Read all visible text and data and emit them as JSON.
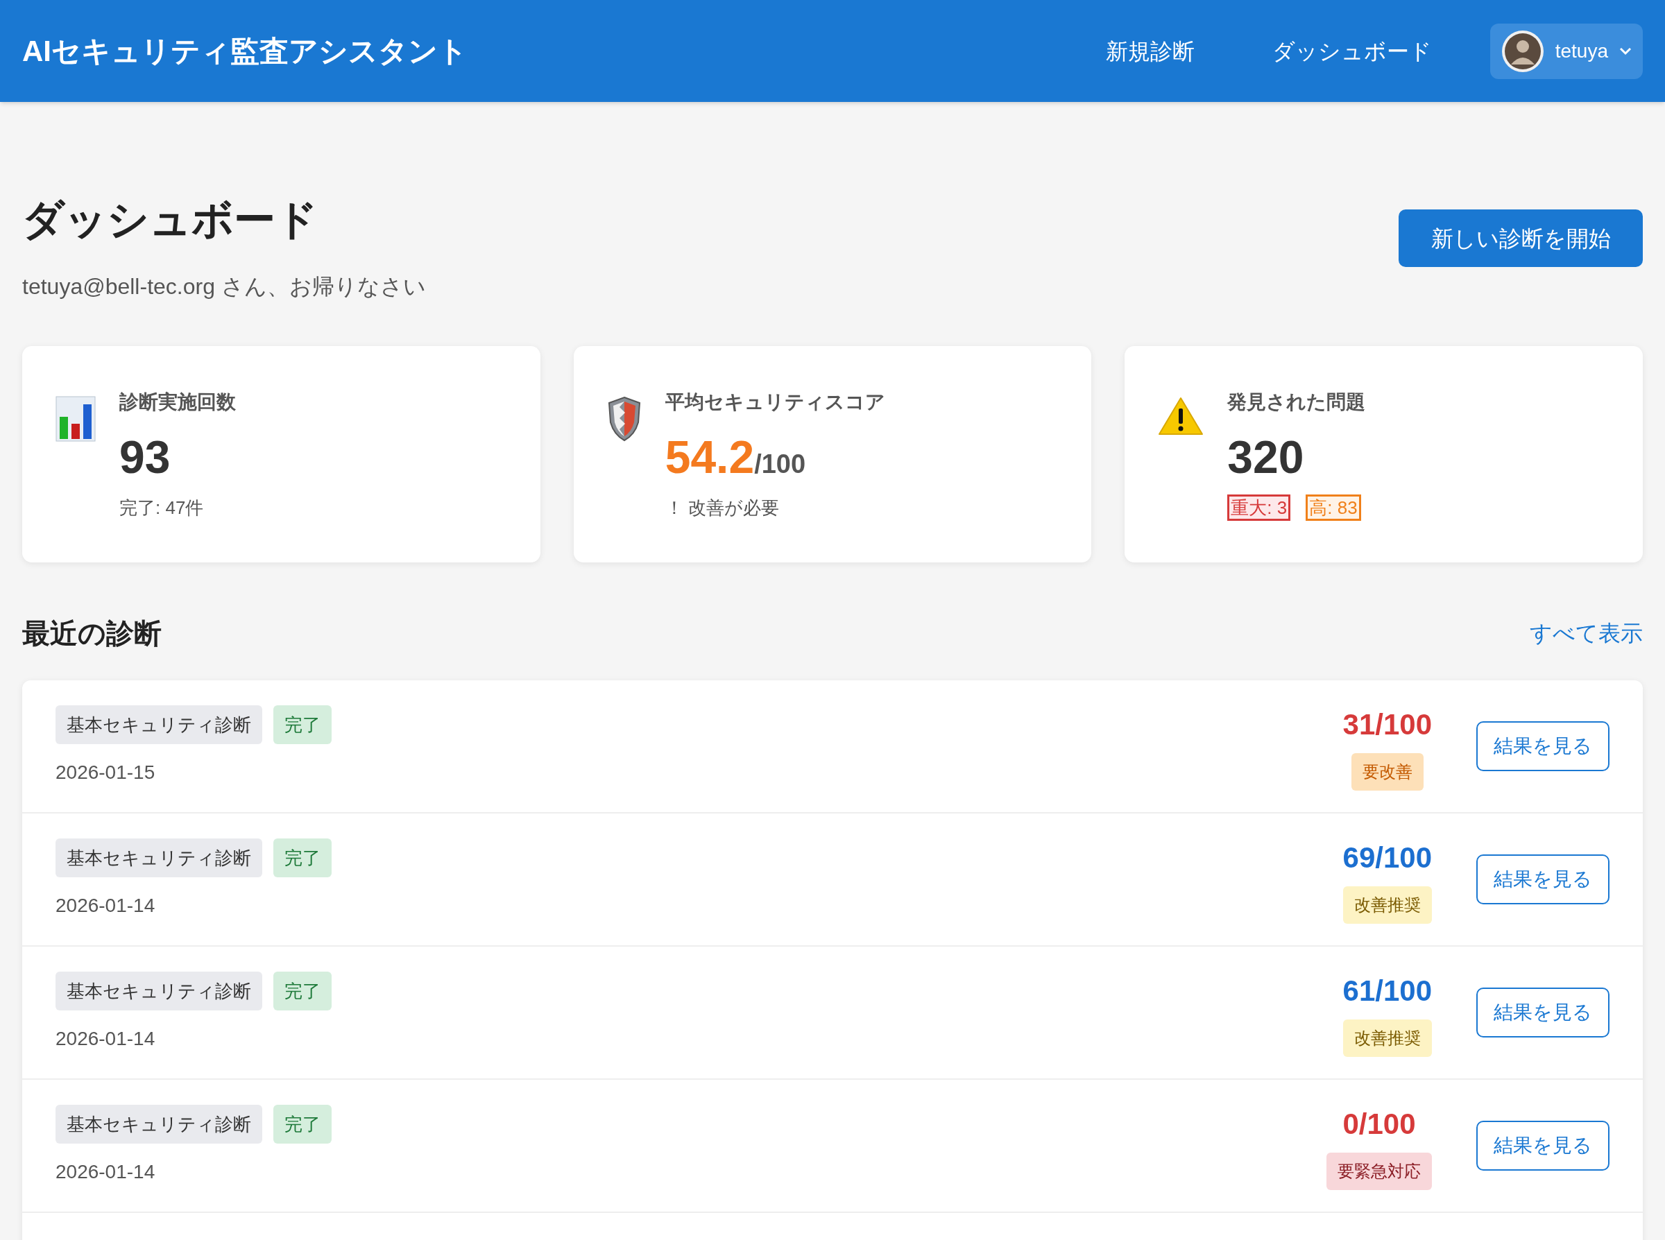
{
  "header": {
    "title": "AIセキュリティ監査アシスタント",
    "nav": [
      {
        "label": "新規診断"
      },
      {
        "label": "ダッシュボード"
      }
    ],
    "user": {
      "name": "tetuya"
    }
  },
  "page": {
    "title": "ダッシュボード",
    "greeting": "tetuya@bell-tec.org さん、お帰りなさい",
    "action": "新しい診断を開始"
  },
  "stats": [
    {
      "kind": "count",
      "label": "診断実施回数",
      "value": "93",
      "note": "完了: 47件"
    },
    {
      "kind": "score",
      "label": "平均セキュリティスコア",
      "value": "54.2",
      "suffix": "/100",
      "note": "！ 改善が必要"
    },
    {
      "kind": "issues",
      "label": "発見された問題",
      "value": "320",
      "badges": [
        {
          "kind": "critical",
          "text": "重大: 3"
        },
        {
          "kind": "high",
          "text": "高: 83"
        }
      ]
    }
  ],
  "recent": {
    "title": "最近の診断",
    "link": "すべて表示",
    "rows": [
      {
        "type": "基本セキュリティ診断",
        "status": "完了",
        "date": "2026-01-15",
        "score": "31/100",
        "kind": "poor",
        "verdict": "要改善",
        "button": "結果を見る"
      },
      {
        "type": "基本セキュリティ診断",
        "status": "完了",
        "date": "2026-01-14",
        "score": "69/100",
        "kind": "fair",
        "verdict": "改善推奨",
        "button": "結果を見る"
      },
      {
        "type": "基本セキュリティ診断",
        "status": "完了",
        "date": "2026-01-14",
        "score": "61/100",
        "kind": "fair",
        "verdict": "改善推奨",
        "button": "結果を見る"
      },
      {
        "type": "基本セキュリティ診断",
        "status": "完了",
        "date": "2026-01-14",
        "score": "0/100",
        "kind": "critical",
        "verdict": "要緊急対応",
        "button": "結果を見る"
      }
    ]
  }
}
